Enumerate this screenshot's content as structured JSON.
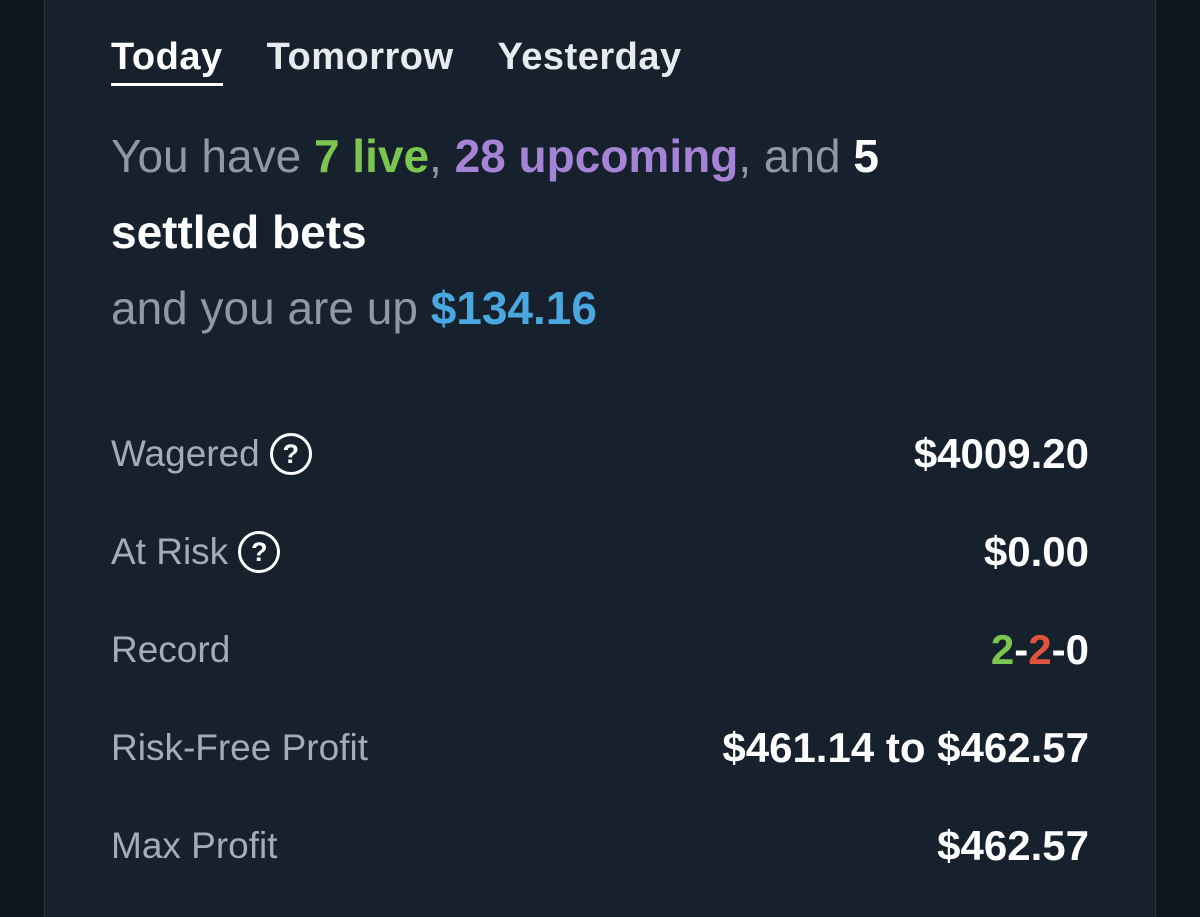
{
  "tabs": [
    {
      "label": "Today",
      "active": true
    },
    {
      "label": "Tomorrow",
      "active": false
    },
    {
      "label": "Yesterday",
      "active": false
    }
  ],
  "summary": {
    "prefix": "You have ",
    "live": "7 live",
    "sep1": ", ",
    "upcoming": "28 upcoming",
    "sep2": ", and ",
    "settled": "5 settled bets",
    "line2_prefix": "and you are up ",
    "amount": "$134.16"
  },
  "stats": {
    "wagered": {
      "label": "Wagered",
      "value": "$4009.20",
      "help_icon": "question-circle-icon"
    },
    "at_risk": {
      "label": "At Risk",
      "value": "$0.00",
      "help_icon": "question-circle-icon"
    },
    "record": {
      "label": "Record",
      "wins": "2",
      "losses": "2",
      "pushes": "0",
      "separator": "-"
    },
    "risk_free_profit": {
      "label": "Risk-Free Profit",
      "value": "$461.14 to $462.57"
    },
    "max_profit": {
      "label": "Max Profit",
      "value": "$462.57"
    }
  },
  "colors": {
    "live": "#7cc64f",
    "upcoming": "#a584d6",
    "up_amount": "#4aa8e0",
    "loss": "#e0533e",
    "background": "#17212d"
  }
}
